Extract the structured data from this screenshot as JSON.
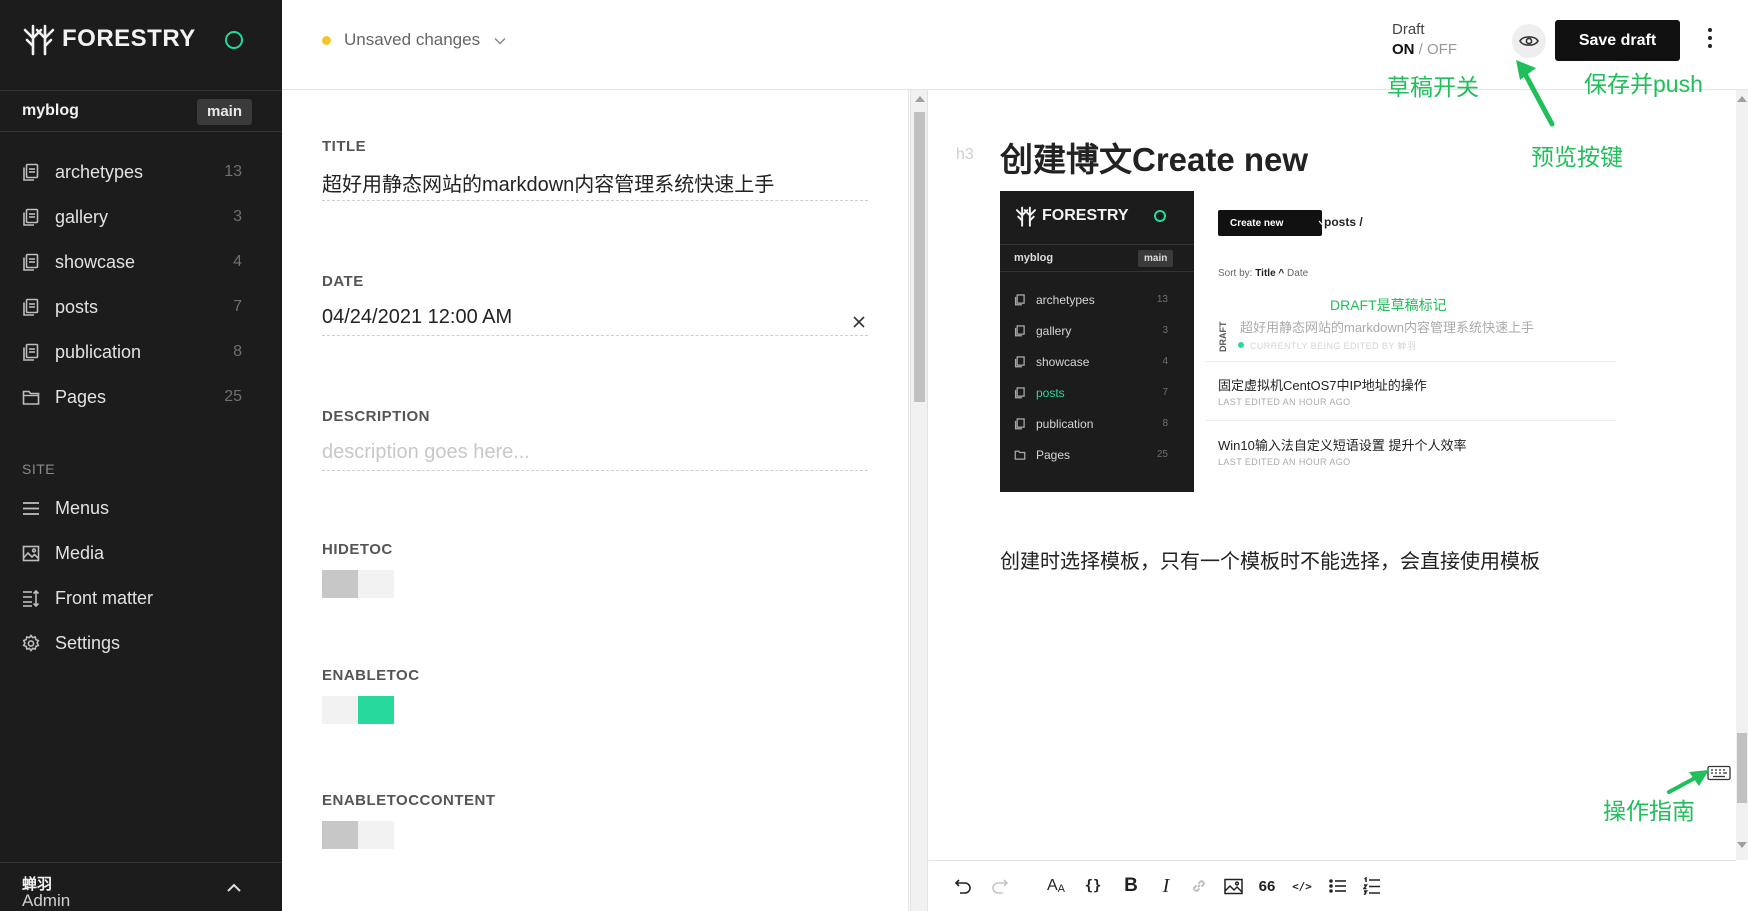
{
  "app": {
    "name": "FORESTRY"
  },
  "sidebar": {
    "site_name": "myblog",
    "branch": "main",
    "sections": [
      {
        "label": "archetypes",
        "count": "13",
        "icon": "document-stack-icon"
      },
      {
        "label": "gallery",
        "count": "3",
        "icon": "document-stack-icon"
      },
      {
        "label": "showcase",
        "count": "4",
        "icon": "document-stack-icon"
      },
      {
        "label": "posts",
        "count": "7",
        "icon": "document-stack-icon"
      },
      {
        "label": "publication",
        "count": "8",
        "icon": "document-stack-icon"
      },
      {
        "label": "Pages",
        "count": "25",
        "icon": "folder-icon"
      }
    ],
    "site_heading": "SITE",
    "site_items": [
      {
        "label": "Menus",
        "icon": "hamburger-icon"
      },
      {
        "label": "Media",
        "icon": "image-icon"
      },
      {
        "label": "Front matter",
        "icon": "sort-list-icon"
      },
      {
        "label": "Settings",
        "icon": "gear-icon"
      }
    ],
    "user": {
      "name": "蝉羽",
      "role": "Admin"
    }
  },
  "topbar": {
    "status": "Unsaved changes",
    "draft_label": "Draft",
    "draft_on": "ON",
    "draft_sep": "/",
    "draft_off": "OFF",
    "save_label": "Save draft"
  },
  "form": {
    "title": {
      "label": "TITLE",
      "value": "超好用静态网站的markdown内容管理系统快速上手"
    },
    "date": {
      "label": "DATE",
      "value": "04/24/2021 12:00 AM"
    },
    "description": {
      "label": "DESCRIPTION",
      "value": "",
      "placeholder": "description goes here..."
    },
    "hidetoc": {
      "label": "HIDETOC",
      "state": "off"
    },
    "enabletoc": {
      "label": "ENABLETOC",
      "state": "on"
    },
    "enabletoccontent": {
      "label": "ENABLETOCCONTENT",
      "state": "off"
    }
  },
  "editor": {
    "heading_tag": "h3",
    "heading": "创建博文Create new",
    "paragraph": "创建时选择模板，只有一个模板时不能选择，会直接使用模板",
    "screenshot": {
      "logo": "FORESTRY",
      "site_name": "myblog",
      "branch": "main",
      "items": [
        {
          "label": "archetypes",
          "count": "13"
        },
        {
          "label": "gallery",
          "count": "3"
        },
        {
          "label": "showcase",
          "count": "4"
        },
        {
          "label": "posts",
          "count": "7"
        },
        {
          "label": "publication",
          "count": "8"
        },
        {
          "label": "Pages",
          "count": "25"
        }
      ],
      "create_label": "Create new",
      "breadcrumb": "posts /",
      "sort_prefix": "Sort by:",
      "sort_title": "Title ^",
      "sort_date": "Date",
      "draft_tag": "DRAFT",
      "annotation": "DRAFT是草稿标记",
      "posts": [
        {
          "title": "超好用静态网站的markdown内容管理系统快速上手",
          "meta": "CURRENTLY BEING EDITED BY 蝉羽"
        },
        {
          "title": "固定虚拟机CentOS7中IP地址的操作",
          "meta": "LAST EDITED AN HOUR AGO"
        },
        {
          "title": "Win10输入法自定义短语设置 提升个人效率",
          "meta": "LAST EDITED AN HOUR AGO"
        }
      ]
    },
    "toolbar": [
      {
        "name": "undo-icon",
        "glyph": "↶"
      },
      {
        "name": "redo-icon",
        "glyph": "↷"
      },
      {
        "name": "font-size-icon",
        "glyph": "AA"
      },
      {
        "name": "code-braces-icon",
        "glyph": "{}"
      },
      {
        "name": "bold-icon",
        "glyph": "B"
      },
      {
        "name": "italic-icon",
        "glyph": "I"
      },
      {
        "name": "link-icon",
        "glyph": "🔗"
      },
      {
        "name": "image-icon",
        "glyph": "▣"
      },
      {
        "name": "quote-icon",
        "glyph": "66"
      },
      {
        "name": "code-icon",
        "glyph": "</>"
      },
      {
        "name": "bullet-list-icon",
        "glyph": "≔"
      },
      {
        "name": "numbered-list-icon",
        "glyph": "☰"
      }
    ]
  },
  "annotations": {
    "draft_switch": "草稿开关",
    "save_push": "保存并push",
    "preview": "预览按键",
    "guide": "操作指南"
  },
  "colors": {
    "sidebar_bg": "#1c1c1c",
    "accent_green": "#27d99c",
    "annotation_green": "#1fbf5a",
    "unsaved_dot": "#f4c430"
  }
}
